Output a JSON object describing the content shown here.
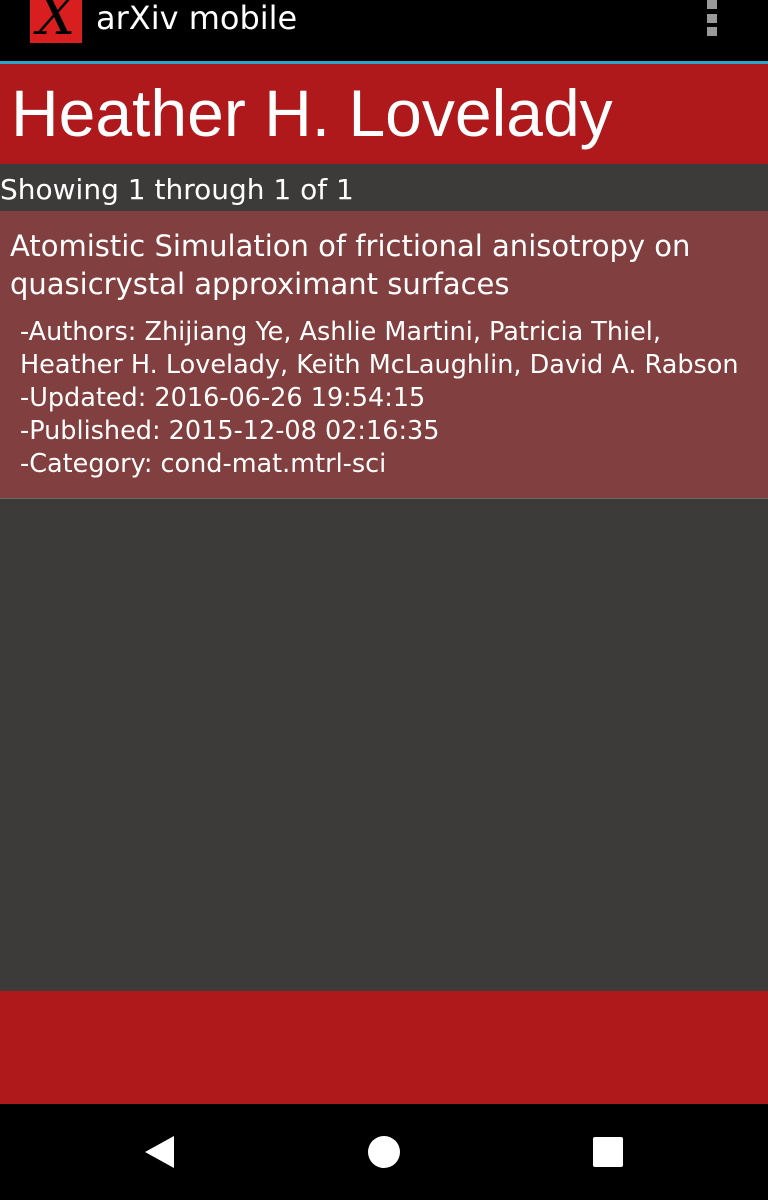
{
  "action_bar": {
    "logo_letter": "X",
    "app_title": "arXiv mobile"
  },
  "author_name": "Heather H. Lovelady",
  "results_summary": "Showing 1 through 1 of 1",
  "articles": [
    {
      "title": "Atomistic Simulation of frictional anisotropy on quasicrystal approximant surfaces",
      "authors": "-Authors: Zhijiang Ye, Ashlie Martini, Patricia Thiel, Heather H. Lovelady, Keith McLaughlin, David A. Rabson",
      "updated": "-Updated: 2016-06-26 19:54:15",
      "published": "-Published: 2015-12-08 02:16:35",
      "category": "-Category: cond-mat.mtrl-sci"
    }
  ],
  "nav_bar": {
    "back_icon": "back-triangle-icon",
    "home_icon": "home-circle-icon",
    "recents_icon": "recents-square-icon"
  },
  "colors": {
    "accent_red": "#b0191b",
    "card_red": "#823f3f",
    "background": "#3c3b3a",
    "divider_blue": "#2fa3cc"
  }
}
